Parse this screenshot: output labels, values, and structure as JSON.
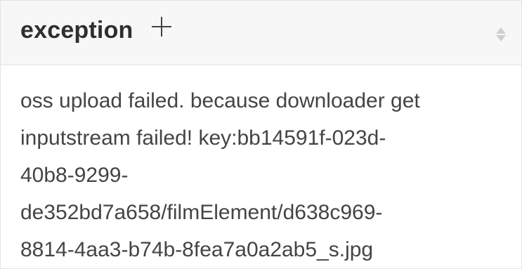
{
  "column": {
    "title": "exception",
    "add_icon": "plus-icon",
    "sort_icon": "sort-icon"
  },
  "cell": {
    "lines": [
      "oss upload failed. because downloader get",
      "inputstream failed! key:bb14591f-023d-",
      "40b8-9299-",
      "de352bd7a658/filmElement/d638c969-",
      "8814-4aa3-b74b-8fea7a0a2ab5_s.jpg"
    ]
  },
  "colors": {
    "header_background": "#f7f7f7",
    "text": "#444444",
    "sort_icon": "#cfcfcf"
  }
}
